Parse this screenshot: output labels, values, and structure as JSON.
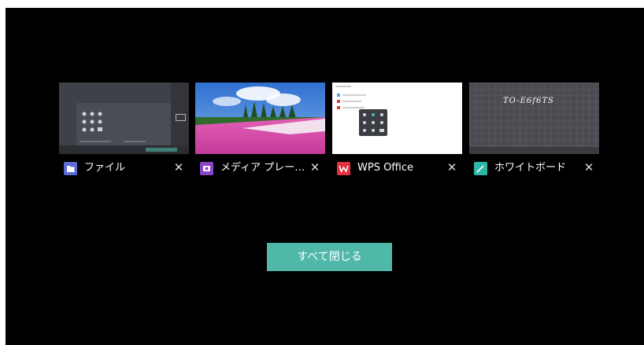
{
  "recent_apps": [
    {
      "name": "ファイル",
      "icon": "folder-icon",
      "icon_color": "#5b6bd6"
    },
    {
      "name": "メディア プレー…",
      "icon": "media-player-icon",
      "icon_color": "#8a44c8"
    },
    {
      "name": "WPS Office",
      "icon": "wps-icon",
      "icon_color": "#e3323b"
    },
    {
      "name": "ホワイトボード",
      "icon": "pen-icon",
      "icon_color": "#2fb6a7"
    }
  ],
  "whiteboard_text": "TO-E6f6TS",
  "close_glyph": "✕",
  "close_all_label": "すべて閉じる",
  "accent_color": "#4fb8a8"
}
